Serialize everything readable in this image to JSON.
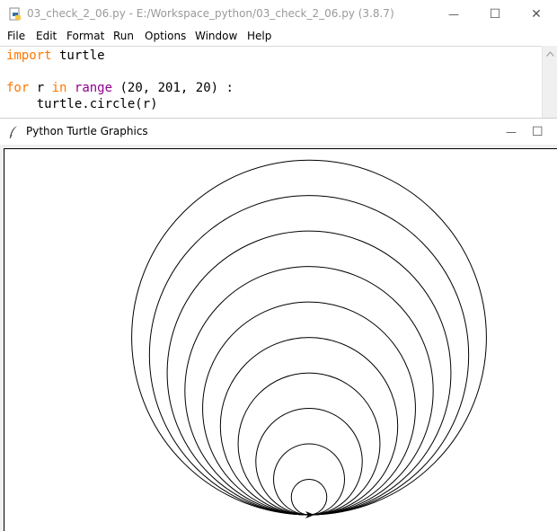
{
  "idle_window": {
    "title": "03_check_2_06.py - E:/Workspace_python/03_check_2_06.py (3.8.7)",
    "controls": {
      "minimize": "—",
      "maximize": "☐",
      "close": "✕"
    },
    "menu": [
      "File",
      "Edit",
      "Format",
      "Run",
      "Options",
      "Window",
      "Help"
    ],
    "code": {
      "line1": {
        "keyword": "import",
        "rest": " turtle"
      },
      "line3": {
        "kw_for": "for",
        "var": " r ",
        "kw_in": "in",
        "space": " ",
        "builtin": "range",
        "args": " (20, 201, 20) :"
      },
      "line4": "    turtle.circle(r)"
    }
  },
  "turtle_window": {
    "title": "Python Turtle Graphics",
    "controls": {
      "minimize": "—",
      "maximize": "☐"
    }
  },
  "drawing": {
    "radii": [
      20,
      40,
      60,
      80,
      100,
      120,
      140,
      160,
      180,
      200
    ],
    "stroke_color": "#000000",
    "syntax_colors": {
      "keyword": "#ff7700",
      "builtin": "#900090"
    }
  }
}
